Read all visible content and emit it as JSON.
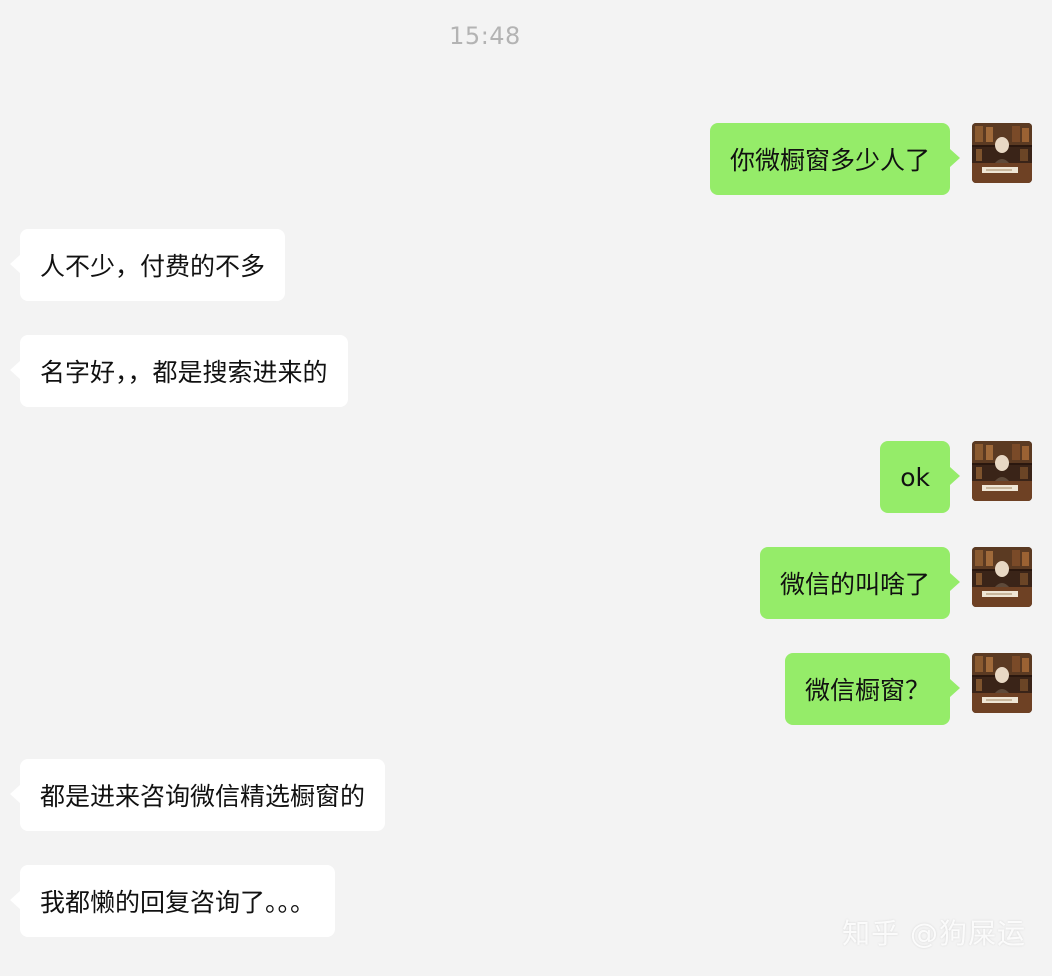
{
  "chat": {
    "timestamp": "15:48",
    "messages": [
      {
        "side": "out",
        "text": "你微橱窗多少人了"
      },
      {
        "side": "in",
        "text": "人不少，付费的不多"
      },
      {
        "side": "in",
        "text": "名字好，，都是搜索进来的"
      },
      {
        "side": "out",
        "text": "ok"
      },
      {
        "side": "out",
        "text": "微信的叫啥了"
      },
      {
        "side": "out",
        "text": "微信橱窗？"
      },
      {
        "side": "in",
        "text": "都是进来咨询微信精选橱窗的"
      },
      {
        "side": "in",
        "text": "我都懒的回复咨询了。。。"
      }
    ]
  },
  "watermark": "知乎 @狗屎运",
  "colors": {
    "background": "#f3f3f3",
    "incoming_bubble": "#ffffff",
    "outgoing_bubble": "#95ec69"
  },
  "icons": {
    "user_avatar": "user-avatar-photo"
  }
}
